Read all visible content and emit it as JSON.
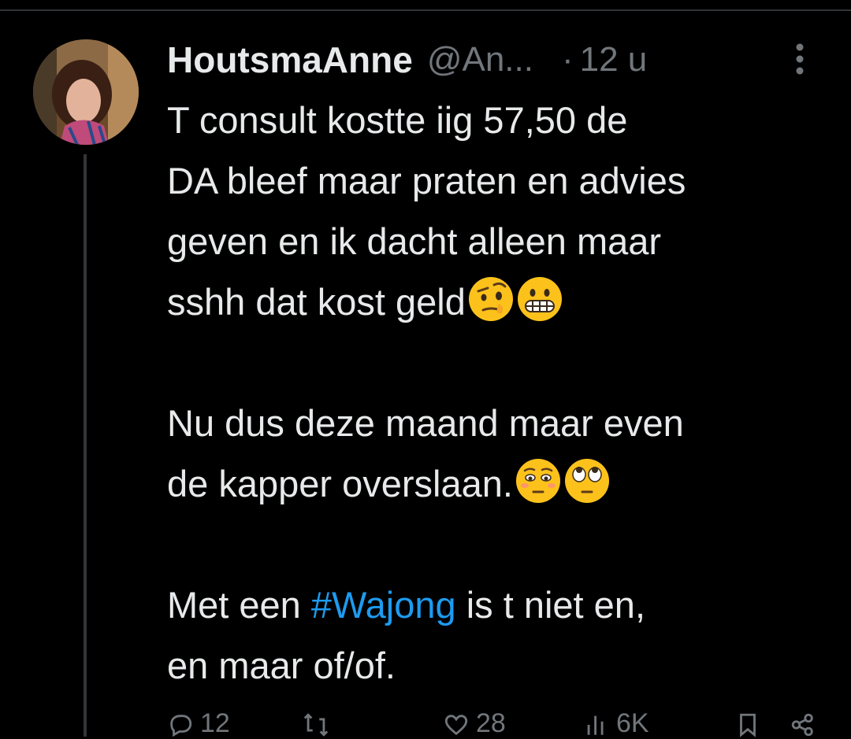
{
  "tweet": {
    "author_name": "HoutsmaAnne",
    "author_handle": "@An...",
    "separator": "·",
    "time": "12 u",
    "lines": [
      "T consult kostte iig 57,50 de",
      "DA bleef maar praten en advies",
      "geven en ik dacht alleen maar",
      "sshh dat kost geld",
      "Nu dus deze maand maar even",
      "de kapper overslaan.",
      "Met een ",
      "#Wajong",
      " is t niet en,",
      "en maar of/of."
    ]
  },
  "actions": {
    "reply_count": "12",
    "retweet_count": "",
    "like_count": "28",
    "views_count": "6K"
  },
  "icons": {
    "more": "more-dots-icon",
    "reply": "reply-icon",
    "retweet": "retweet-icon",
    "like": "heart-icon",
    "views": "views-icon",
    "bookmark": "bookmark-icon",
    "share": "share-icon",
    "emoji_1": "raised-eyebrow-emoji",
    "emoji_2": "grimacing-emoji",
    "emoji_3": "relieved-emoji",
    "emoji_4": "eye-roll-emoji"
  },
  "colors": {
    "background": "#000000",
    "text": "#e7e9ea",
    "secondary": "#71767b",
    "hashtag": "#1d9bf0",
    "thread_line": "#333639"
  }
}
